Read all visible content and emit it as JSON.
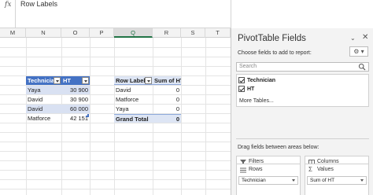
{
  "formula_bar": {
    "fx": "fx",
    "content": "Row Labels"
  },
  "columns": [
    {
      "label": "M",
      "selected": false
    },
    {
      "label": "N",
      "selected": false
    },
    {
      "label": "O",
      "selected": false
    },
    {
      "label": "P",
      "selected": false
    },
    {
      "label": "Q",
      "selected": true
    },
    {
      "label": "R",
      "selected": false
    },
    {
      "label": "S",
      "selected": false
    },
    {
      "label": "T",
      "selected": false
    }
  ],
  "source_table": {
    "headers": [
      "Technician",
      "HT"
    ],
    "rows": [
      [
        "Yaya",
        "30 900"
      ],
      [
        "David",
        "30 900"
      ],
      [
        "David",
        "60 000"
      ],
      [
        "Matforce",
        "42 151"
      ]
    ]
  },
  "pivot_table": {
    "headers": [
      "Row Labels",
      "Sum of HT"
    ],
    "rows": [
      [
        "David",
        "0"
      ],
      [
        "Matforce",
        "0"
      ],
      [
        "Yaya",
        "0"
      ]
    ],
    "total": [
      "Grand Total",
      "0"
    ]
  },
  "pane": {
    "title": "PivotTable Fields",
    "chevron": "⌄",
    "close": "✕",
    "choose_label": "Choose fields to add to report:",
    "search_placeholder": "Search",
    "fields": [
      {
        "label": "Technician",
        "checked": true
      },
      {
        "label": "HT",
        "checked": true
      }
    ],
    "more_tables": "More Tables...",
    "drag_label": "Drag fields between areas below:",
    "areas": {
      "filters": {
        "title": "Filters",
        "items": []
      },
      "columns": {
        "title": "Columns",
        "items": []
      },
      "rows": {
        "title": "Rows",
        "items": [
          "Technician"
        ]
      },
      "values": {
        "title": "Values",
        "items": [
          "Sum of HT"
        ]
      }
    }
  },
  "colors": {
    "table_header": "#4472c4",
    "table_band": "#d9e1f2",
    "pivot_header": "#dde5f4",
    "accent": "#217346"
  }
}
